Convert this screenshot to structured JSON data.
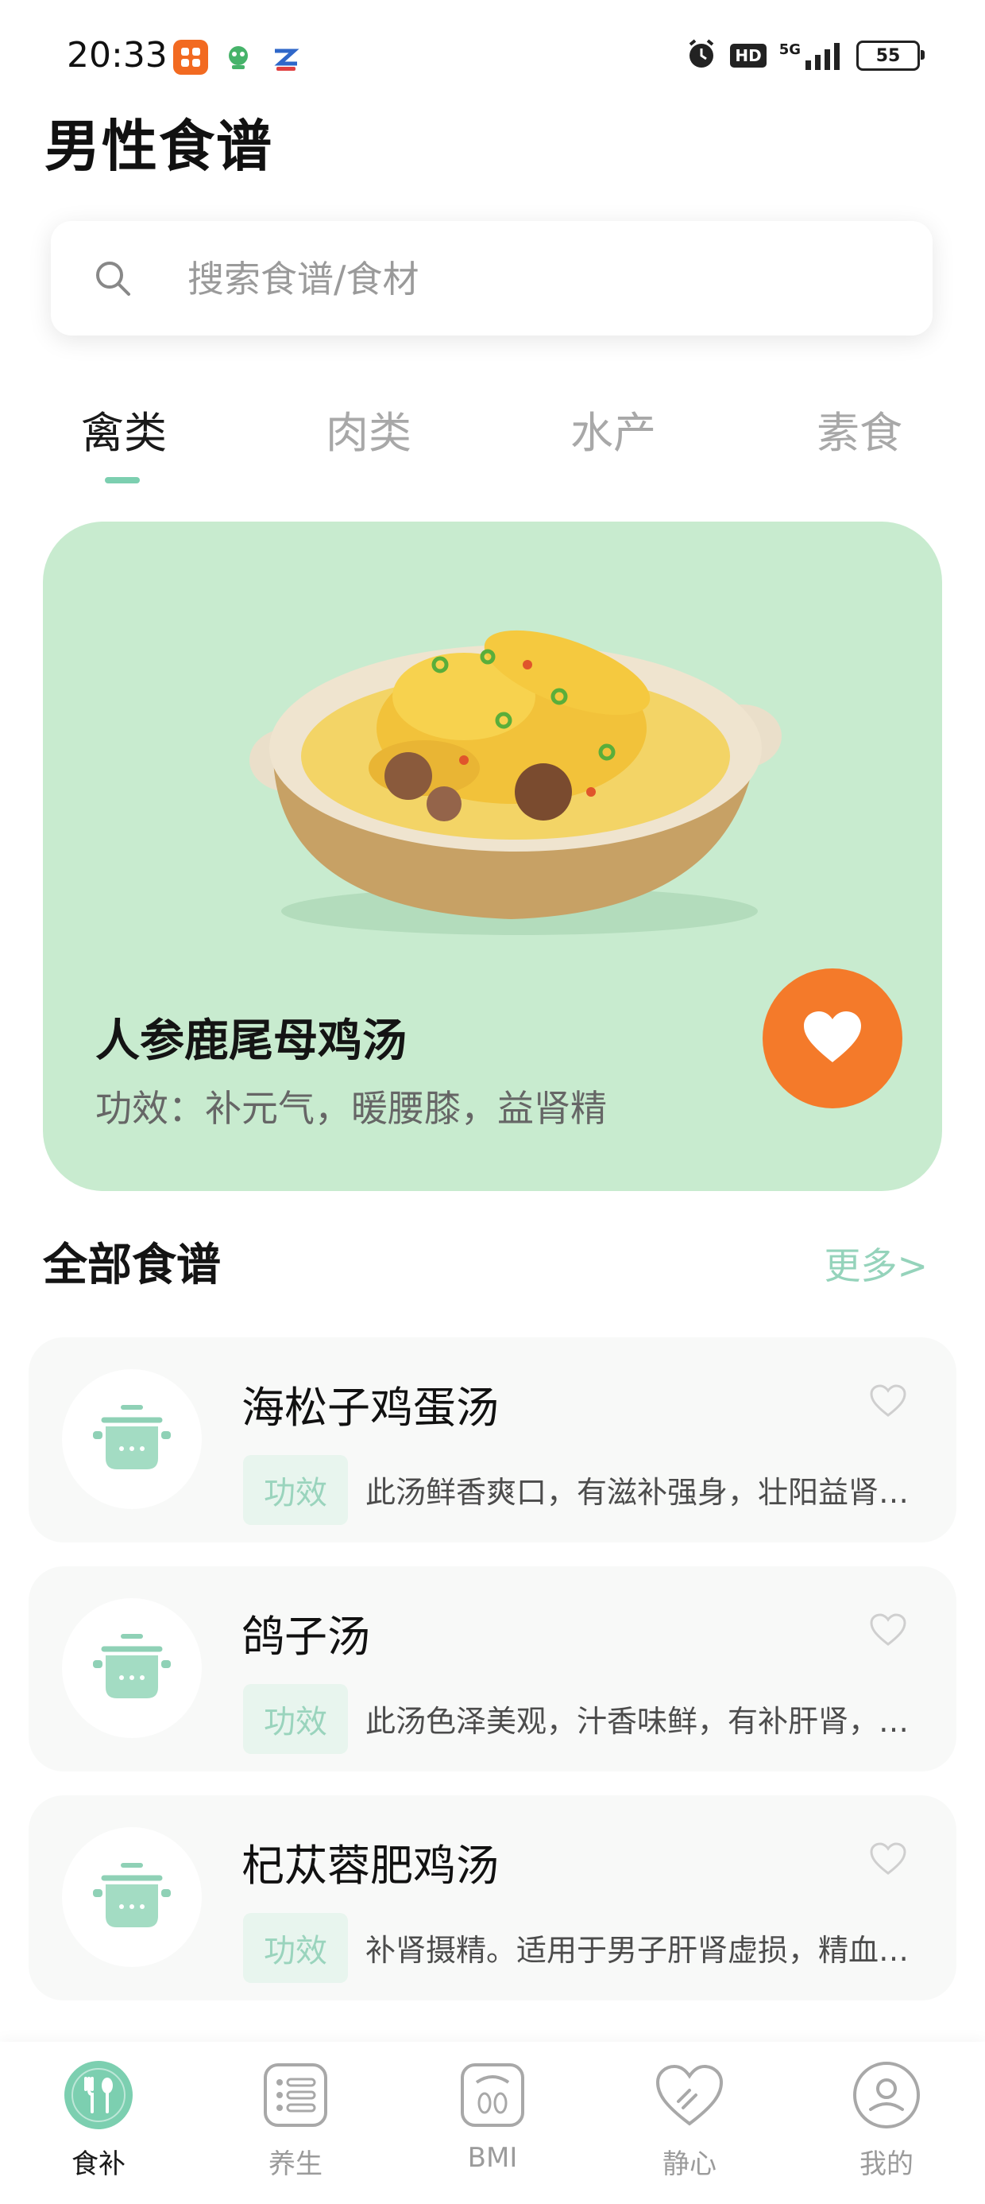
{
  "status_bar": {
    "time": "20:33",
    "battery": "55",
    "network": "5G",
    "hd": "HD",
    "icons": [
      "app-notification-icon",
      "app-notification-icon",
      "app-notification-icon",
      "alarm-icon",
      "hd-icon",
      "signal-icon",
      "battery-icon"
    ]
  },
  "header": {
    "title": "男性食谱"
  },
  "search": {
    "placeholder": "搜索食谱/食材",
    "value": ""
  },
  "tabs": [
    {
      "label": "禽类",
      "active": true
    },
    {
      "label": "肉类",
      "active": false
    },
    {
      "label": "水产",
      "active": false
    },
    {
      "label": "素食",
      "active": false
    }
  ],
  "featured": {
    "title": "人参鹿尾母鸡汤",
    "description": "功效：补元气，暖腰膝，益肾精",
    "background": "#c8ebcf",
    "favorite_color": "#f47a2a",
    "icon": "heart-icon"
  },
  "section": {
    "title": "全部食谱",
    "more": "更多>"
  },
  "recipes": [
    {
      "name": "海松子鸡蛋汤",
      "tag": "功效",
      "description": "此汤鲜香爽口，有滋补强身，壮阳益肾…"
    },
    {
      "name": "鸽子汤",
      "tag": "功效",
      "description": "此汤色泽美观，汁香味鲜，有补肝肾，…"
    },
    {
      "name": "杞苁蓉肥鸡汤",
      "tag": "功效",
      "description": "补肾摄精。适用于男子肝肾虚损，精血…"
    }
  ],
  "bottom_nav": [
    {
      "label": "食补",
      "icon": "fork-spoon-icon",
      "active": true
    },
    {
      "label": "养生",
      "icon": "list-icon",
      "active": false
    },
    {
      "label": "BMI",
      "icon": "scale-icon",
      "active": false
    },
    {
      "label": "静心",
      "icon": "heart-pulse-icon",
      "active": false
    },
    {
      "label": "我的",
      "icon": "user-icon",
      "active": false
    }
  ],
  "colors": {
    "accent": "#7ccfb0",
    "accent_light": "#95d3bb",
    "orange": "#f47a2a"
  }
}
